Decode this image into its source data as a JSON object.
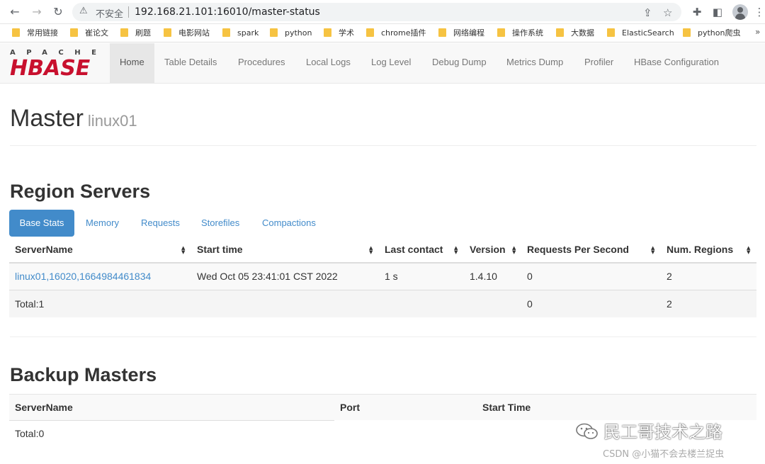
{
  "browser": {
    "insecure_label": "不安全",
    "url": "192.168.21.101:16010/master-status",
    "bookmarks": [
      "常用链接",
      "崔论文",
      "刷题",
      "电影网站",
      "spark",
      "python",
      "学术",
      "chrome插件",
      "网络编程",
      "操作系统",
      "大数据",
      "ElasticSearch",
      "python爬虫"
    ],
    "more_label": "»"
  },
  "logo": {
    "top": "APACHE",
    "main": "HBASE"
  },
  "nav": [
    "Home",
    "Table Details",
    "Procedures",
    "Local Logs",
    "Log Level",
    "Debug Dump",
    "Metrics Dump",
    "Profiler",
    "HBase Configuration"
  ],
  "master": {
    "title": "Master",
    "host": "linux01"
  },
  "region_servers": {
    "title": "Region Servers",
    "tabs": [
      "Base Stats",
      "Memory",
      "Requests",
      "Storefiles",
      "Compactions"
    ],
    "columns": [
      "ServerName",
      "Start time",
      "Last contact",
      "Version",
      "Requests Per Second",
      "Num. Regions"
    ],
    "row": {
      "server": "linux01,16020,1664984461834",
      "start": "Wed Oct 05 23:41:01 CST 2022",
      "last_contact": "1 s",
      "version": "1.4.10",
      "rps": "0",
      "regions": "2"
    },
    "total": {
      "label": "Total:1",
      "rps": "0",
      "regions": "2"
    }
  },
  "backup_masters": {
    "title": "Backup Masters",
    "columns": [
      "ServerName",
      "Port",
      "Start Time"
    ],
    "total": "Total:0"
  },
  "watermark": {
    "line1": "民工哥技术之路",
    "line2": "CSDN @小猫不会去楼兰捉虫"
  },
  "colors": {
    "link": "#428bca",
    "hbase_red": "#c8102e",
    "navbar_bg": "#f8f8f8"
  }
}
